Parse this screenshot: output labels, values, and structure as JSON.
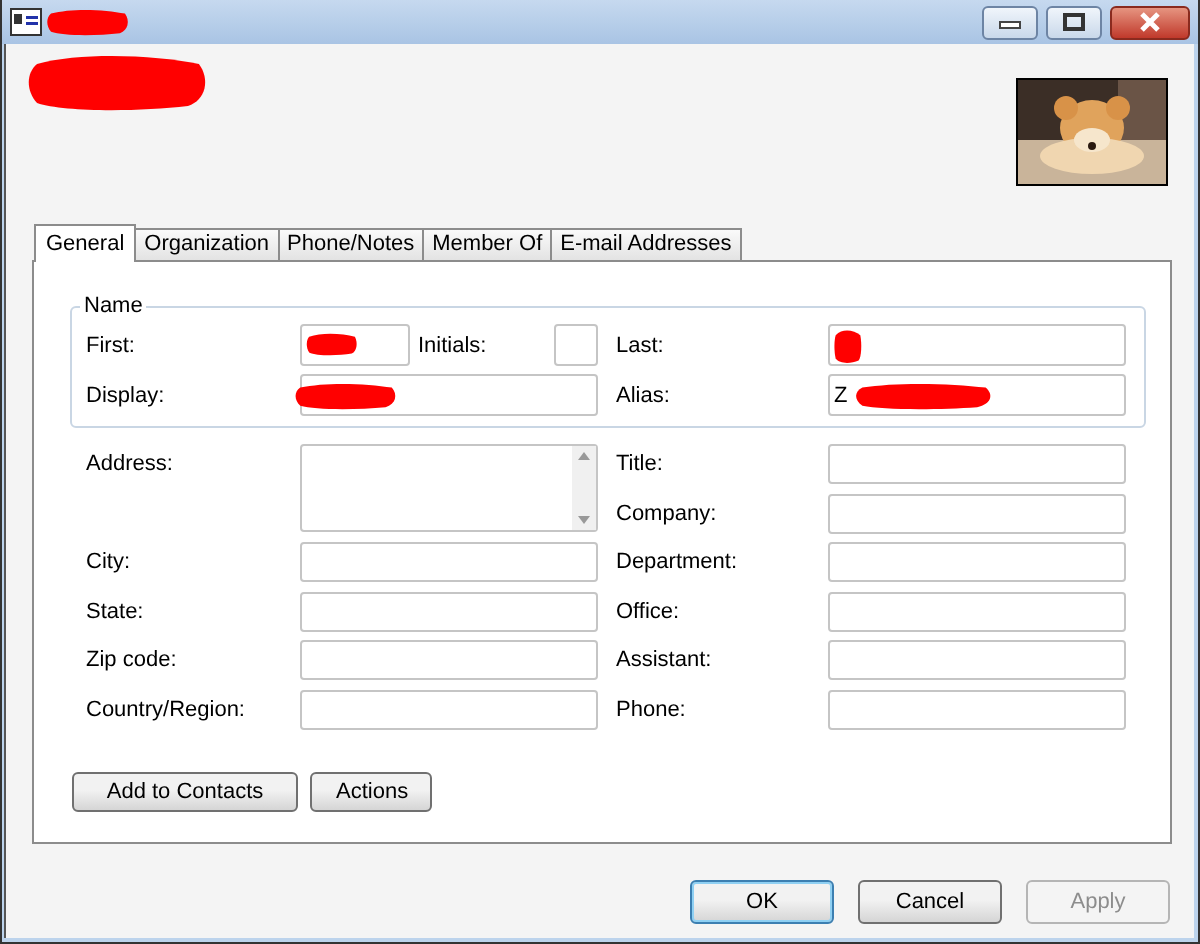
{
  "window": {
    "controls": [
      {
        "kind": "minimize"
      },
      {
        "kind": "maximize"
      },
      {
        "kind": "close"
      }
    ]
  },
  "header": {
    "photo": {
      "kind": "picture"
    }
  },
  "tabs": [
    {
      "label": "General",
      "selected": true
    },
    {
      "label": "Organization",
      "selected": false
    },
    {
      "label": "Phone/Notes",
      "selected": false
    },
    {
      "label": "Member Of",
      "selected": false
    },
    {
      "label": "E-mail Addresses",
      "selected": false
    }
  ],
  "name_group": {
    "title": "Name",
    "fields": [
      {
        "kind": "first",
        "label": "First:"
      },
      {
        "kind": "initials",
        "label": "Initials:"
      },
      {
        "kind": "last",
        "label": "Last:"
      },
      {
        "kind": "display",
        "label": "Display:"
      },
      {
        "kind": "alias",
        "label": "Alias:",
        "value": "Z"
      }
    ]
  },
  "left_fields": [
    {
      "label": "Address:",
      "kind": "multiline"
    },
    {
      "label": "City:",
      "kind": "text"
    },
    {
      "label": "State:",
      "kind": "text"
    },
    {
      "label": "Zip code:",
      "kind": "text"
    },
    {
      "label": "Country/Region:",
      "kind": "text"
    }
  ],
  "right_fields": [
    {
      "label": "Title:"
    },
    {
      "label": "Company:"
    },
    {
      "label": "Department:"
    },
    {
      "label": "Office:"
    },
    {
      "label": "Assistant:"
    },
    {
      "label": "Phone:"
    }
  ],
  "panel_buttons": [
    "Add to Contacts",
    "Actions"
  ],
  "dialog_buttons": [
    {
      "label": "OK",
      "kind": "default",
      "disabled": false
    },
    {
      "label": "Cancel",
      "kind": "normal",
      "disabled": false
    },
    {
      "label": "Apply",
      "kind": "normal",
      "disabled": true
    }
  ]
}
